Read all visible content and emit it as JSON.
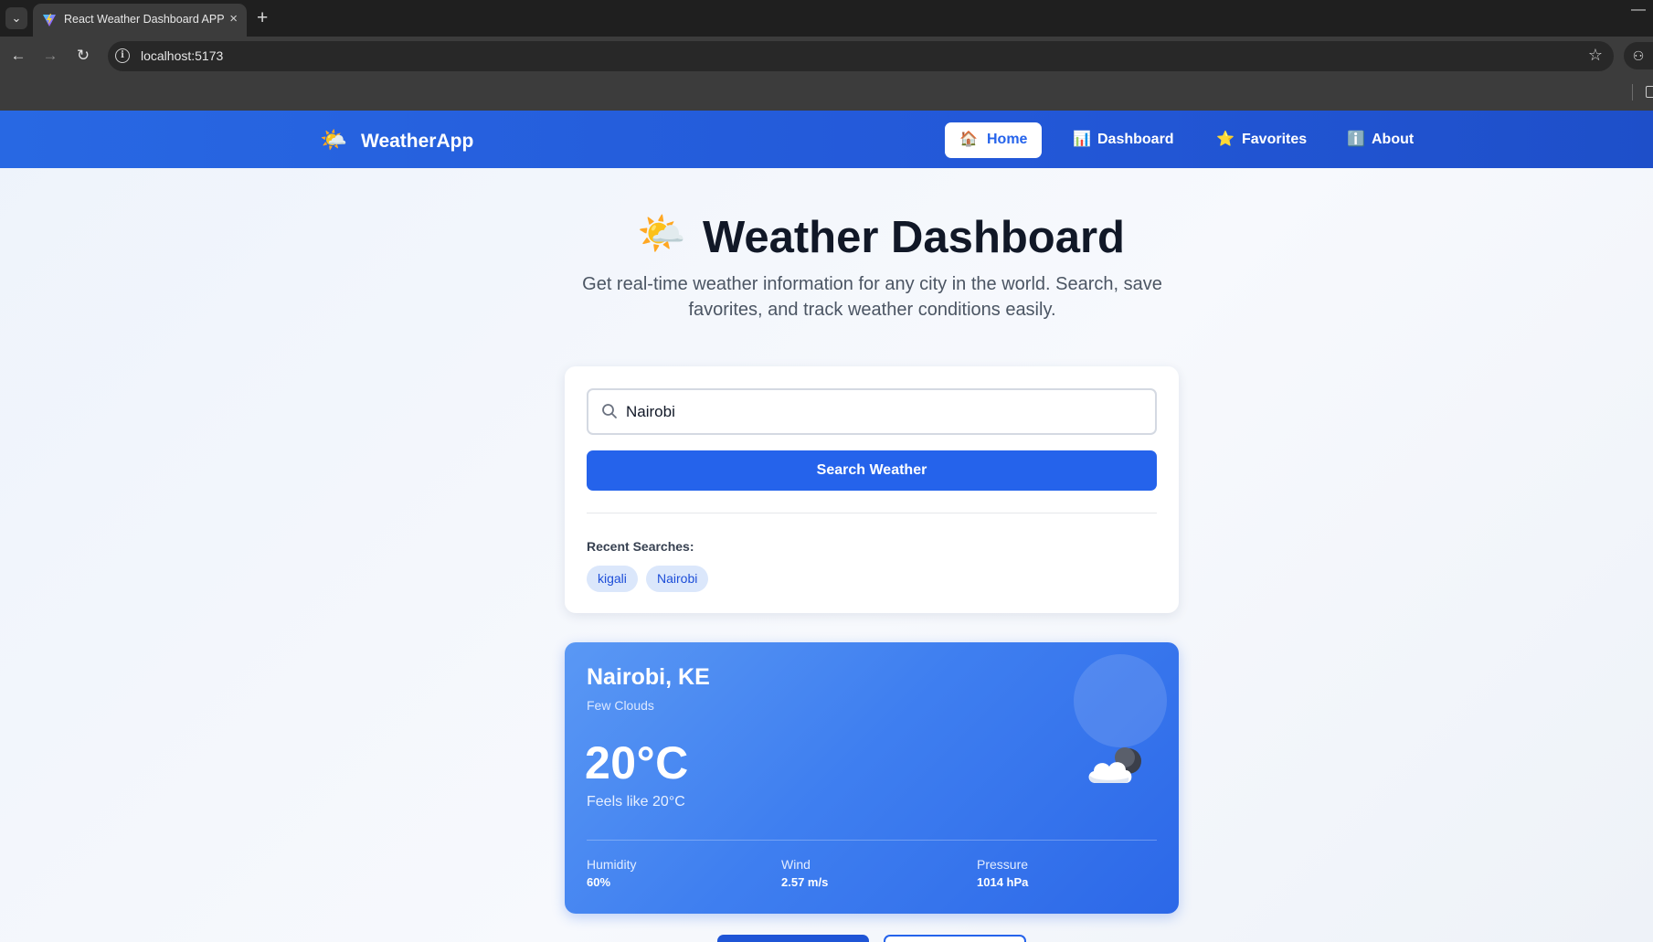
{
  "browser": {
    "tab_title": "React Weather Dashboard APP",
    "tab_close": "×",
    "new_tab": "+",
    "url": "localhost:5173"
  },
  "nav": {
    "brand": "WeatherApp",
    "brand_emoji": "🌤️",
    "items": [
      {
        "label": "Home",
        "icon": "🏠",
        "active": true
      },
      {
        "label": "Dashboard",
        "icon": "📊",
        "active": false
      },
      {
        "label": "Favorites",
        "icon": "⭐",
        "active": false
      },
      {
        "label": "About",
        "icon": "ℹ️",
        "active": false
      }
    ]
  },
  "hero": {
    "emoji": "🌤️",
    "title": "Weather Dashboard",
    "subtitle": "Get real-time weather information for any city in the world. Search, save favorites, and track weather conditions easily."
  },
  "search": {
    "value": "Nairobi",
    "button_label": "Search Weather",
    "recent_label": "Recent Searches:",
    "recent": [
      "kigali",
      "Nairobi"
    ]
  },
  "weather": {
    "city": "Nairobi, KE",
    "description": "Few Clouds",
    "temperature": "20°C",
    "feels_like": "Feels like 20°C",
    "icon": "cloud-night-icon",
    "stats": [
      {
        "label": "Humidity",
        "value": "60%"
      },
      {
        "label": "Wind",
        "value": "2.57 m/s"
      },
      {
        "label": "Pressure",
        "value": "1014 hPa"
      }
    ]
  },
  "colors": {
    "primary": "#2563eb",
    "nav_gradient_start": "#2868e3",
    "nav_gradient_end": "#1e4fc9",
    "chip_bg": "#dbe7fb",
    "card_gradient_start": "#5a98f4",
    "card_gradient_end": "#2c68e8"
  }
}
